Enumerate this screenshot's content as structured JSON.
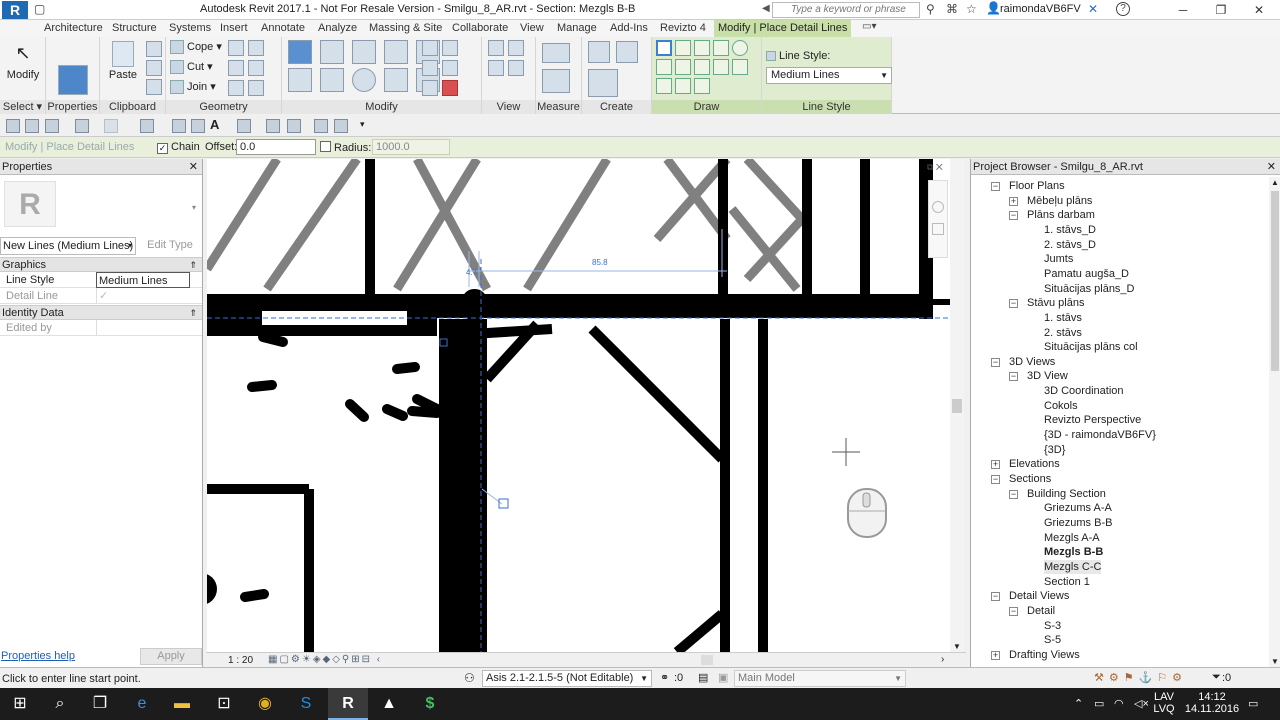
{
  "titlebar": {
    "app_letter": "R",
    "title": "Autodesk Revit 2017.1 - Not For Resale Version -    Smilgu_8_AR.rvt - Section: Mezgls B-B",
    "search_placeholder": "Type a keyword or phrase",
    "user": "raimondaVB6FV",
    "help": "?"
  },
  "tabs": [
    "Architecture",
    "Structure",
    "Systems",
    "Insert",
    "Annotate",
    "Analyze",
    "Massing & Site",
    "Collaborate",
    "View",
    "Manage",
    "Add-Ins",
    "Revizto 4",
    "Modify | Place Detail Lines"
  ],
  "ribbon": {
    "select_label": "Select",
    "modify_label": "Modify",
    "properties_label": "Properties",
    "clipboard_label": "Clipboard",
    "paste_label": "Paste",
    "cope_label": "Cope",
    "cut_label": "Cut",
    "join_label": "Join",
    "geometry_label": "Geometry",
    "modify_panel_label": "Modify",
    "view_label": "View",
    "measure_label": "Measure",
    "create_label": "Create",
    "draw_label": "Draw",
    "line_style_panel": "Line Style",
    "line_style_caption": "Line Style:",
    "line_style_value": "Medium Lines"
  },
  "optbar": {
    "context": "Modify | Place Detail Lines",
    "chain_label": "Chain",
    "chain_checked": true,
    "offset_label": "Offset:",
    "offset_value": "0.0",
    "radius_label": "Radius:",
    "radius_value": "1000.0",
    "radius_checked": false
  },
  "properties": {
    "title": "Properties",
    "type_selector": "New Lines (Medium Lines)",
    "edit_type": "Edit Type",
    "sections": [
      {
        "name": "Graphics",
        "rows": [
          {
            "key": "Line Style",
            "value": "Medium Lines"
          },
          {
            "key": "Detail Line",
            "value": "✓"
          }
        ]
      },
      {
        "name": "Identity Data",
        "rows": [
          {
            "key": "Edited by",
            "value": ""
          }
        ]
      }
    ],
    "help_link": "Properties help",
    "apply": "Apply"
  },
  "canvas": {
    "dim1": "4.7",
    "dim2": "85.8"
  },
  "view_control": {
    "scale": "1 : 20"
  },
  "project_browser": {
    "title": "Project Browser - Smilgu_8_AR.rvt",
    "nodes": [
      {
        "label": "Floor Plans",
        "level": 1,
        "exp": "−"
      },
      {
        "label": "Mēbeļu plāns",
        "level": 2,
        "exp": "+"
      },
      {
        "label": "Plāns darbam",
        "level": 2,
        "exp": "−"
      },
      {
        "label": "1. stāvs_D",
        "level": 3
      },
      {
        "label": "2. stāvs_D",
        "level": 3
      },
      {
        "label": "Jumts",
        "level": 3
      },
      {
        "label": "Pamatu augša_D",
        "level": 3
      },
      {
        "label": "Situācijas plāns_D",
        "level": 3
      },
      {
        "label": "Stāvu plāns",
        "level": 2,
        "exp": "−"
      },
      {
        "label": "1. stāvs",
        "level": 3
      },
      {
        "label": "2. stāvs",
        "level": 3
      },
      {
        "label": "Situācijas plāns col",
        "level": 3
      },
      {
        "label": "3D Views",
        "level": 1,
        "exp": "−"
      },
      {
        "label": "3D View",
        "level": 2,
        "exp": "−"
      },
      {
        "label": "3D Coordination",
        "level": 3
      },
      {
        "label": "Cokols",
        "level": 3
      },
      {
        "label": "Revizto Perspective",
        "level": 3
      },
      {
        "label": "{3D - raimondaVB6FV}",
        "level": 3
      },
      {
        "label": "{3D}",
        "level": 3
      },
      {
        "label": "Elevations",
        "level": 1,
        "exp": "+"
      },
      {
        "label": "Sections",
        "level": 1,
        "exp": "−"
      },
      {
        "label": "Building Section",
        "level": 2,
        "exp": "−"
      },
      {
        "label": "Griezums A-A",
        "level": 3
      },
      {
        "label": "Griezums B-B",
        "level": 3
      },
      {
        "label": "Mezgls A-A",
        "level": 3
      },
      {
        "label": "Mezgls B-B",
        "level": 3,
        "bold": true
      },
      {
        "label": "Mezgls C-C",
        "level": 3,
        "hl": true
      },
      {
        "label": "Section 1",
        "level": 3
      },
      {
        "label": "Detail Views",
        "level": 1,
        "exp": "−"
      },
      {
        "label": "Detail",
        "level": 2,
        "exp": "−"
      },
      {
        "label": "S-3",
        "level": 3
      },
      {
        "label": "S-5",
        "level": 3
      },
      {
        "label": "Drafting Views",
        "level": 1,
        "exp": "+"
      }
    ]
  },
  "status": {
    "message": "Click to enter line start point.",
    "workset": "Asis 2.1-2.1.5-5 (Not Editable)",
    "zero1": ":0",
    "model": "Main Model",
    "filter_count": ":0"
  },
  "taskbar": {
    "lang1": "LAV",
    "lang2": "LVQ",
    "time": "14:12",
    "date": "14.11.2016"
  },
  "colors": {
    "accent_tab": "#c8e0a8",
    "optbar_bg": "#e8f0dc",
    "link": "#1f5fb8",
    "revit_blue": "#1e6ab3"
  }
}
